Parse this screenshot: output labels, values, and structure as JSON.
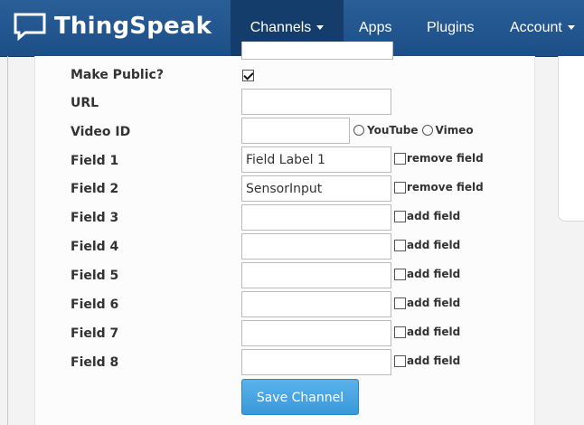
{
  "navbar": {
    "brand": "ThingSpeak",
    "items": [
      {
        "label": "Channels",
        "has_caret": true,
        "active": true
      },
      {
        "label": "Apps",
        "has_caret": false
      },
      {
        "label": "Plugins",
        "has_caret": false
      },
      {
        "label": "Account",
        "has_caret": true
      }
    ]
  },
  "form": {
    "make_public_label": "Make Public?",
    "make_public_checked": true,
    "url_label": "URL",
    "url_value": "",
    "video_id_label": "Video ID",
    "video_id_value": "",
    "video_options": [
      "YouTube",
      "Vimeo"
    ],
    "fields": [
      {
        "label": "Field 1",
        "value": "Field Label 1",
        "action": "remove field"
      },
      {
        "label": "Field 2",
        "value": "SensorInput",
        "action": "remove field"
      },
      {
        "label": "Field 3",
        "value": "",
        "action": "add field"
      },
      {
        "label": "Field 4",
        "value": "",
        "action": "add field"
      },
      {
        "label": "Field 5",
        "value": "",
        "action": "add field"
      },
      {
        "label": "Field 6",
        "value": "",
        "action": "add field"
      },
      {
        "label": "Field 7",
        "value": "",
        "action": "add field"
      },
      {
        "label": "Field 8",
        "value": "",
        "action": "add field"
      }
    ],
    "save_label": "Save Channel"
  },
  "colors": {
    "navbar": "#2a5e96",
    "navbar_active": "#143d6b",
    "button": "#3a98d9"
  }
}
